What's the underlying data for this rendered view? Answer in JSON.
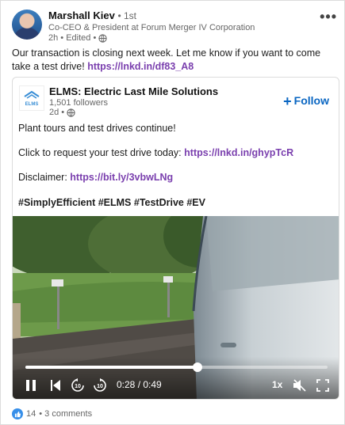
{
  "author": {
    "name": "Marshall Kiev",
    "degree": "• 1st",
    "headline": "Co-CEO & President at Forum Merger IV Corporation",
    "meta": "2h • Edited •",
    "more_label": "•••"
  },
  "post": {
    "text": "Our transaction is closing next week. Let me know if you want to come take a test drive!",
    "link": "https://lnkd.in/df83_A8"
  },
  "shared": {
    "logo_text": "ELMS",
    "org_name": "ELMS: Electric Last Mile Solutions",
    "followers": "1,501 followers",
    "meta": "2d •",
    "follow_label": "Follow",
    "line1": "Plant tours and test drives continue!",
    "line2_text": "Click to request your test drive today:",
    "line2_link": "https://lnkd.in/ghypTcR",
    "line3_text": "Disclaimer:",
    "line3_link": "https://bit.ly/3vbwLNg",
    "hashtags": "#SimplyEfficient #ELMS #TestDrive #EV"
  },
  "video": {
    "time": "0:28 / 0:49",
    "progress": 0.57,
    "speed": "1x",
    "rewind_label": "10",
    "forward_label": "10"
  },
  "footer": {
    "reactions": "14",
    "comments": "• 3 comments"
  },
  "colors": {
    "link": "#7a3fae",
    "follow": "#0a66c2",
    "like": "#378fe9"
  }
}
